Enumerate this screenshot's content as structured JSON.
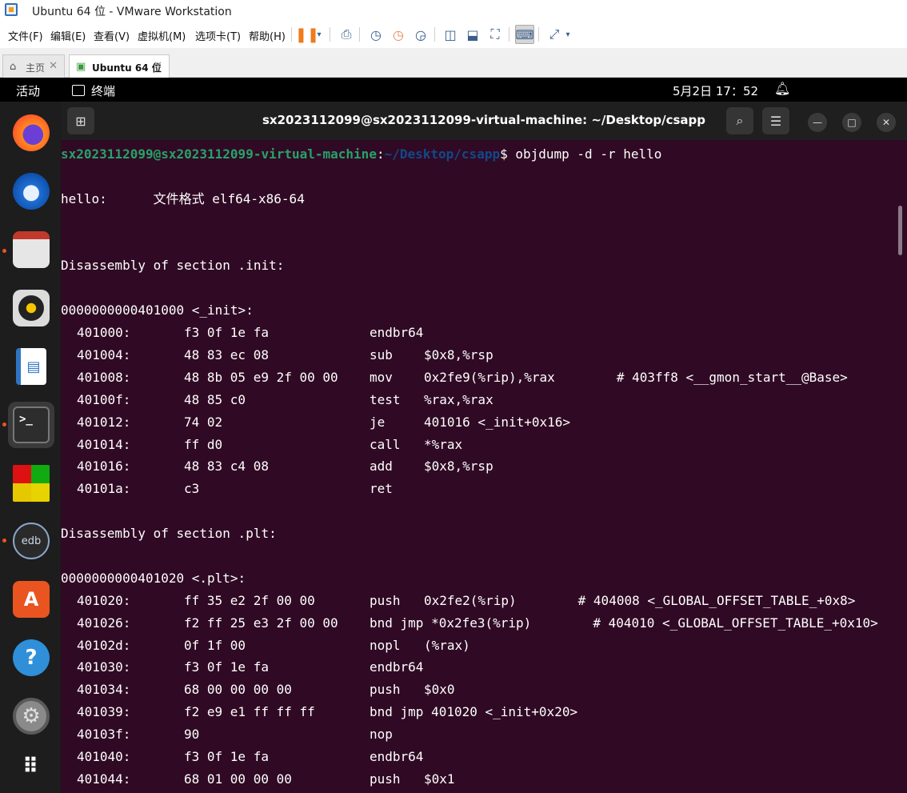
{
  "window": {
    "title": "Ubuntu 64 位 - VMware Workstation"
  },
  "menu": [
    "文件(F)",
    "编辑(E)",
    "查看(V)",
    "虚拟机(M)",
    "选项卡(T)",
    "帮助(H)"
  ],
  "tabs": [
    {
      "label": "主页",
      "active": false
    },
    {
      "label": "Ubuntu 64 位",
      "active": true
    }
  ],
  "topbar": {
    "activities": "活动",
    "app": "终端",
    "clock": "5月2日  17：52"
  },
  "dock": [
    "Firefox",
    "Thunderbird",
    "Files",
    "Rhythmbox",
    "LibreOffice Writer",
    "Terminal",
    "App",
    "edb",
    "App Center",
    "Help",
    "Settings",
    "Show Apps"
  ],
  "terminal": {
    "title": "sx2023112099@sx2023112099-virtual-machine: ~/Desktop/csapp",
    "prompt_user": "sx2023112099@sx2023112099-virtual-machine",
    "prompt_sep": ":",
    "prompt_path": "~/Desktop/csapp",
    "prompt_end": "$ ",
    "command": "objdump -d -r hello",
    "file_line": "hello:      文件格式 elf64-x86-64",
    "section_init": "Disassembly of section .init:",
    "init_label": "0000000000401000 <_init>:",
    "init_rows": [
      {
        "addr": "401000:",
        "bytes": "f3 0f 1e fa",
        "mn": "endbr64",
        "ops": ""
      },
      {
        "addr": "401004:",
        "bytes": "48 83 ec 08",
        "mn": "sub",
        "ops": "$0x8,%rsp"
      },
      {
        "addr": "401008:",
        "bytes": "48 8b 05 e9 2f 00 00",
        "mn": "mov",
        "ops": "0x2fe9(%rip),%rax        # 403ff8 <__gmon_start__@Base>"
      },
      {
        "addr": "40100f:",
        "bytes": "48 85 c0",
        "mn": "test",
        "ops": "%rax,%rax"
      },
      {
        "addr": "401012:",
        "bytes": "74 02",
        "mn": "je",
        "ops": "401016 <_init+0x16>"
      },
      {
        "addr": "401014:",
        "bytes": "ff d0",
        "mn": "call",
        "ops": "*%rax"
      },
      {
        "addr": "401016:",
        "bytes": "48 83 c4 08",
        "mn": "add",
        "ops": "$0x8,%rsp"
      },
      {
        "addr": "40101a:",
        "bytes": "c3",
        "mn": "ret",
        "ops": ""
      }
    ],
    "section_plt": "Disassembly of section .plt:",
    "plt_label": "0000000000401020 <.plt>:",
    "plt_rows": [
      {
        "addr": "401020:",
        "bytes": "ff 35 e2 2f 00 00",
        "mn": "push",
        "ops": "0x2fe2(%rip)        # 404008 <_GLOBAL_OFFSET_TABLE_+0x8>"
      },
      {
        "addr": "401026:",
        "bytes": "f2 ff 25 e3 2f 00 00",
        "mn": "bnd jmp *0x2fe3(%rip)        # 404010 <_GLOBAL_OFFSET_TABLE_+0x10>",
        "ops": ""
      },
      {
        "addr": "40102d:",
        "bytes": "0f 1f 00",
        "mn": "nopl",
        "ops": "(%rax)"
      },
      {
        "addr": "401030:",
        "bytes": "f3 0f 1e fa",
        "mn": "endbr64",
        "ops": ""
      },
      {
        "addr": "401034:",
        "bytes": "68 00 00 00 00",
        "mn": "push",
        "ops": "$0x0"
      },
      {
        "addr": "401039:",
        "bytes": "f2 e9 e1 ff ff ff",
        "mn": "bnd jmp 401020 <_init+0x20>",
        "ops": ""
      },
      {
        "addr": "40103f:",
        "bytes": "90",
        "mn": "nop",
        "ops": ""
      },
      {
        "addr": "401040:",
        "bytes": "f3 0f 1e fa",
        "mn": "endbr64",
        "ops": ""
      },
      {
        "addr": "401044:",
        "bytes": "68 01 00 00 00",
        "mn": "push",
        "ops": "$0x1"
      }
    ]
  }
}
